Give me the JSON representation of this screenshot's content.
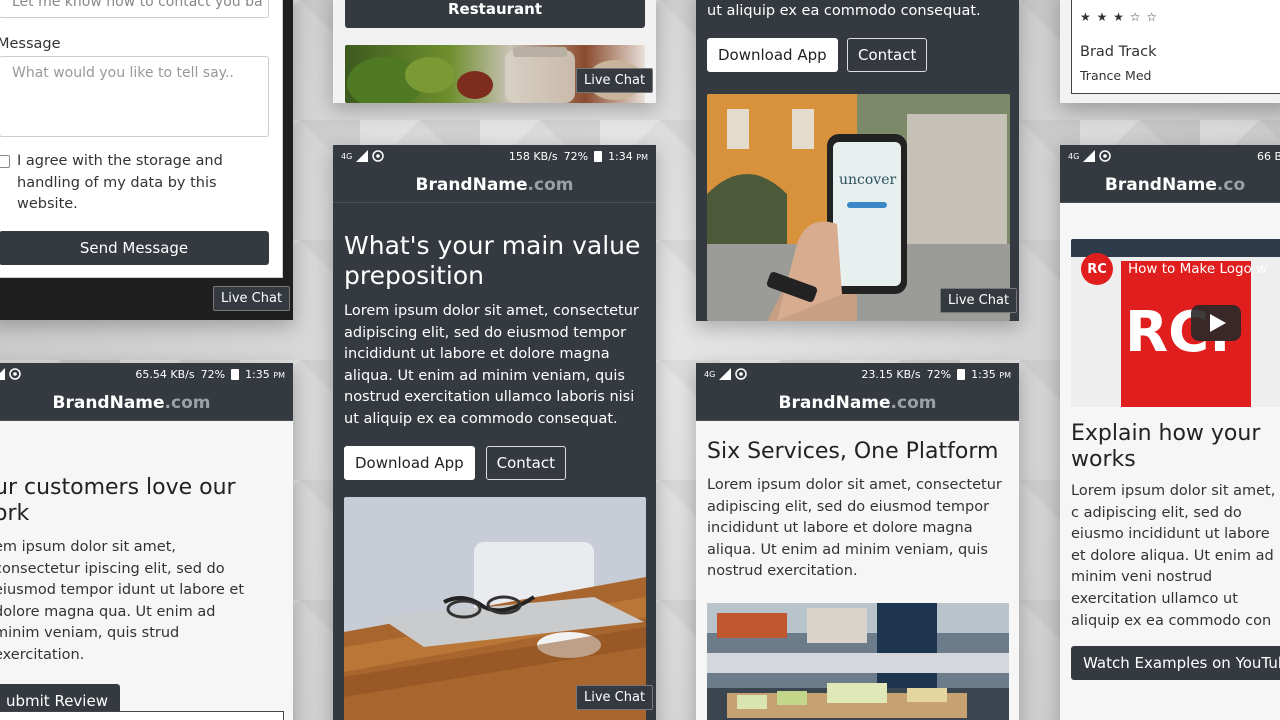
{
  "contact_form": {
    "top_text": "Let me know how to contact you ba",
    "message_label": "Message",
    "message_placeholder": "What would you like to tell say..",
    "agree_text": "I agree with the storage and handling of my data by this website.",
    "send_button": "Send Message",
    "live_chat": "Live Chat"
  },
  "restaurant_panel": {
    "button": "Restaurant",
    "live_chat": "Live Chat"
  },
  "top_mid_right": {
    "text": "ut aliquip ex ea commodo consequat.",
    "download_button": "Download App",
    "contact_button": "Contact",
    "live_chat": "Live Chat"
  },
  "review_card": {
    "stars": "★ ★ ★ ☆ ☆",
    "name": "Brad Track",
    "company": "Trance Med"
  },
  "center_phone": {
    "status": {
      "speed": "158 KB/s",
      "battery": "72%",
      "time": "1:34",
      "ampm": "PM"
    },
    "brand": "BrandName",
    "brand_suffix": ".com",
    "headline": "What's your main value preposition",
    "body": "Lorem ipsum dolor sit amet, consectetur adipiscing elit, sed do eiusmod tempor incididunt ut labore et dolore magna aliqua. Ut enim ad minim veniam, quis nostrud exercitation ullamco laboris nisi ut aliquip ex ea commodo consequat.",
    "download_button": "Download App",
    "contact_button": "Contact",
    "live_chat": "Live Chat"
  },
  "left_phone": {
    "status": {
      "speed": "65.54 KB/s",
      "battery": "72%",
      "time": "1:35",
      "ampm": "PM"
    },
    "brand": "BrandName",
    "brand_suffix": ".com",
    "headline": "ur customers love our ork",
    "body": "em ipsum dolor sit amet, consectetur ipiscing elit, sed do eiusmod tempor idunt ut labore et dolore magna qua. Ut enim ad minim veniam, quis strud exercitation.",
    "review_button": "ubmit Review"
  },
  "right_phone": {
    "status": {
      "speed": "23.15 KB/s",
      "battery": "72%",
      "time": "1:35",
      "ampm": "PM"
    },
    "brand": "BrandName",
    "brand_suffix": ".com",
    "headline": "Six Services, One Platform",
    "body": "Lorem ipsum dolor sit amet, consectetur adipiscing elit, sed do eiusmod tempor incididunt ut labore et dolore magna aliqua. Ut enim ad minim veniam, quis nostrud exercitation."
  },
  "far_right_phone": {
    "status": {
      "speed": "66 B"
    },
    "brand": "BrandName",
    "brand_suffix": ".co",
    "video_title": "How to Make Logo w",
    "channel_badge": "RC",
    "headline": "Explain how your works",
    "body": "Lorem ipsum dolor sit amet, c adipiscing elit, sed do eiusmo incididunt ut labore et dolore aliqua. Ut enim ad minim veni nostrud exercitation ullamco ut aliquip ex ea commodo con",
    "youtube_button": "Watch Examples on YouTub"
  },
  "colors": {
    "dark": "#343a40",
    "light": "#f6f6f6",
    "brand_suffix": "#9aa0a6",
    "youtube_red": "#e01e1e"
  }
}
